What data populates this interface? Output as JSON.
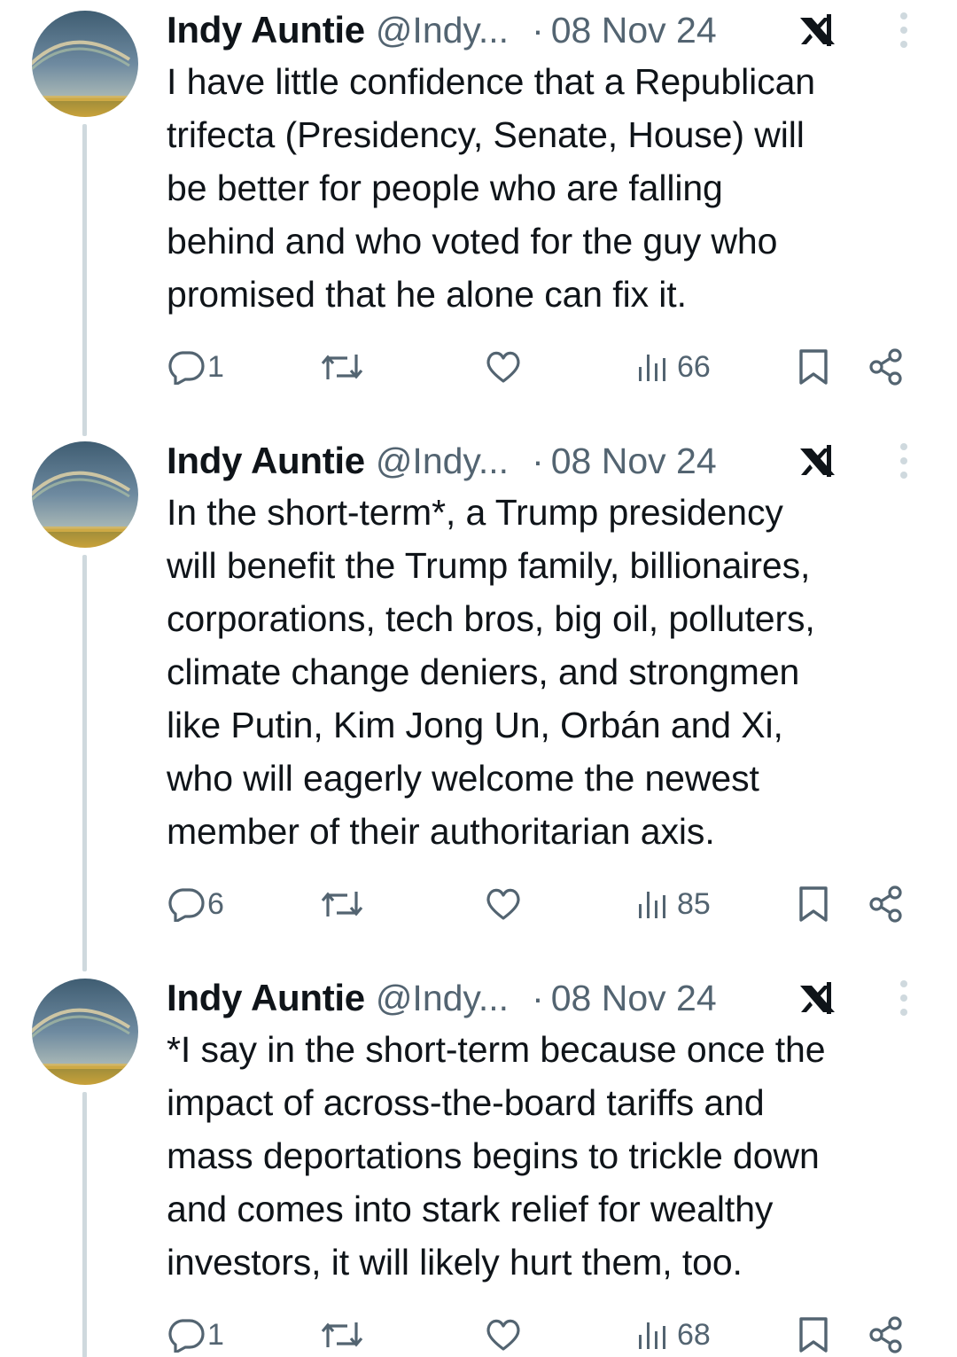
{
  "tweets": [
    {
      "author": "Indy Auntie",
      "handle": "@Indy...",
      "separator": "·",
      "date": "08 Nov 24",
      "lines": [
        "I have little confidence that a Republican",
        "trifecta (Presidency, Senate, House) will",
        "be better for people who are falling",
        "behind and who voted for the guy who",
        "promised that he alone can fix it."
      ],
      "replies": "1",
      "views": "66"
    },
    {
      "author": "Indy Auntie",
      "handle": "@Indy...",
      "separator": "·",
      "date": "08 Nov 24",
      "lines": [
        "In the short-term*, a Trump presidency",
        "will benefit the Trump family, billionaires,",
        "corporations, tech bros, big oil, polluters,",
        "climate change deniers, and strongmen",
        "like Putin, Kim Jong Un, Orbán and Xi,",
        "who will eagerly welcome the newest",
        "member of their authoritarian axis."
      ],
      "replies": "6",
      "views": "85"
    },
    {
      "author": "Indy Auntie",
      "handle": "@Indy...",
      "separator": "·",
      "date": "08 Nov 24",
      "lines": [
        "*I say in the short-term because once the",
        "impact of across-the-board tariffs and",
        "mass deportations begins to trickle down",
        "and comes into stark relief for wealthy",
        "investors, it will likely hurt them, too."
      ],
      "replies": "1",
      "views": "68"
    }
  ],
  "icons": {
    "reply": "reply-icon",
    "repost": "repost-icon",
    "like": "like-icon",
    "views": "views-icon",
    "bookmark": "bookmark-icon",
    "share": "share-icon",
    "grok": "grok-x-icon",
    "more": "more-icon"
  },
  "colors": {
    "text": "#0f1419",
    "muted": "#536471",
    "thread_line": "#cfd9de"
  }
}
